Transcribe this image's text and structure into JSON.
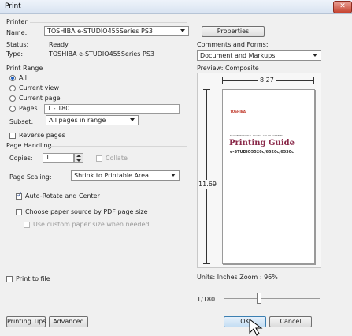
{
  "window": {
    "title": "Print",
    "close_glyph": "✕"
  },
  "printer": {
    "group_label": "Printer",
    "name_label": "Name:",
    "name_value": "TOSHIBA e-STUDIO455Series PS3",
    "status_label": "Status:",
    "status_value": "Ready",
    "type_label": "Type:",
    "type_value": "TOSHIBA e-STUDIO455Series PS3",
    "properties_label": "Properties",
    "comments_label": "Comments and Forms:",
    "comments_value": "Document and Markups"
  },
  "print_range": {
    "group_label": "Print Range",
    "all_label": "All",
    "current_view_label": "Current view",
    "current_page_label": "Current page",
    "pages_label": "Pages",
    "pages_value": "1 - 180",
    "subset_label": "Subset:",
    "subset_value": "All pages in range",
    "reverse_label": "Reverse pages"
  },
  "page_handling": {
    "group_label": "Page Handling",
    "copies_label": "Copies:",
    "copies_value": "1",
    "collate_label": "Collate",
    "scaling_label": "Page Scaling:",
    "scaling_value": "Shrink to Printable Area",
    "auto_rotate_label": "Auto-Rotate and Center",
    "paper_source_label": "Choose paper source by PDF page size",
    "custom_paper_label": "Use custom paper size when needed"
  },
  "print_to_file_label": "Print to file",
  "preview": {
    "label": "Preview: Composite",
    "width_value": "8.27",
    "height_value": "11.69",
    "doc_brand": "TOSHIBA",
    "doc_subtitle": "MULTIFUNCTIONAL DIGITAL COLOR SYSTEMS",
    "doc_title": "Printing Guide",
    "doc_model": "e-STUDIO5520c/6520c/6530c",
    "units_label": "Units: Inches Zoom :  96%",
    "page_indicator": "1/180"
  },
  "buttons": {
    "printing_tips": "Printing Tips",
    "advanced": "Advanced",
    "ok": "OK",
    "cancel": "Cancel"
  }
}
